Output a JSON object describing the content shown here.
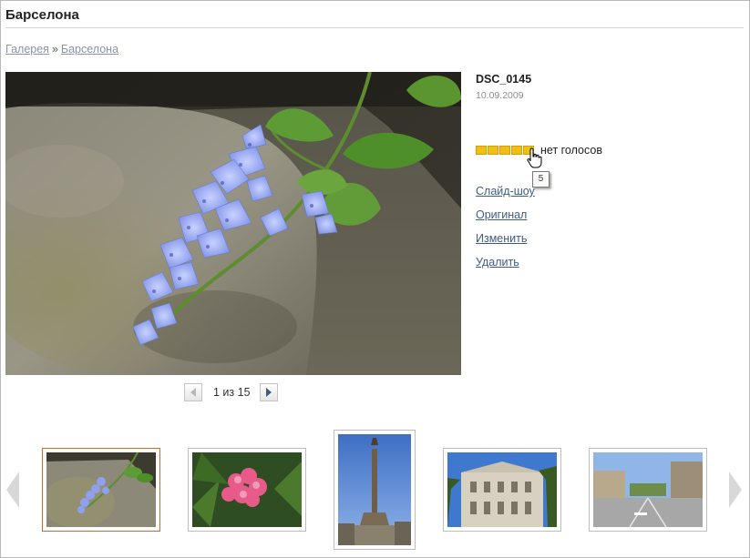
{
  "page": {
    "title": "Барселона"
  },
  "breadcrumb": {
    "gallery": "Галерея",
    "separator": "»",
    "album": "Барселона"
  },
  "photo": {
    "name": "DSC_0145",
    "date": "10.09.2009",
    "rating": {
      "stars": 5,
      "votes_text": "нет голосов",
      "hover_tooltip": "5",
      "star_color": "#f0be14"
    }
  },
  "actions": {
    "slideshow": "Слайд-шоу",
    "original": "Оригинал",
    "edit": "Изменить",
    "delete": "Удалить"
  },
  "pager": {
    "label": "1 из 15",
    "prev_icon": "arrow-left-icon",
    "next_icon": "arrow-right-icon"
  },
  "filmstrip": {
    "prev_icon": "chevron-left-icon",
    "next_icon": "chevron-right-icon",
    "selected_border": "#d3662a",
    "thumbnails": [
      {
        "subject": "blue-flowers",
        "selected": true
      },
      {
        "subject": "pink-flowers",
        "selected": false
      },
      {
        "subject": "columbus-monument",
        "selected": false
      },
      {
        "subject": "building-facade",
        "selected": false
      },
      {
        "subject": "street-view",
        "selected": false
      }
    ]
  },
  "colors": {
    "link": "#3e5b86",
    "breadcrumb_link": "#8a94a3",
    "date_text": "#8d8d8d"
  }
}
